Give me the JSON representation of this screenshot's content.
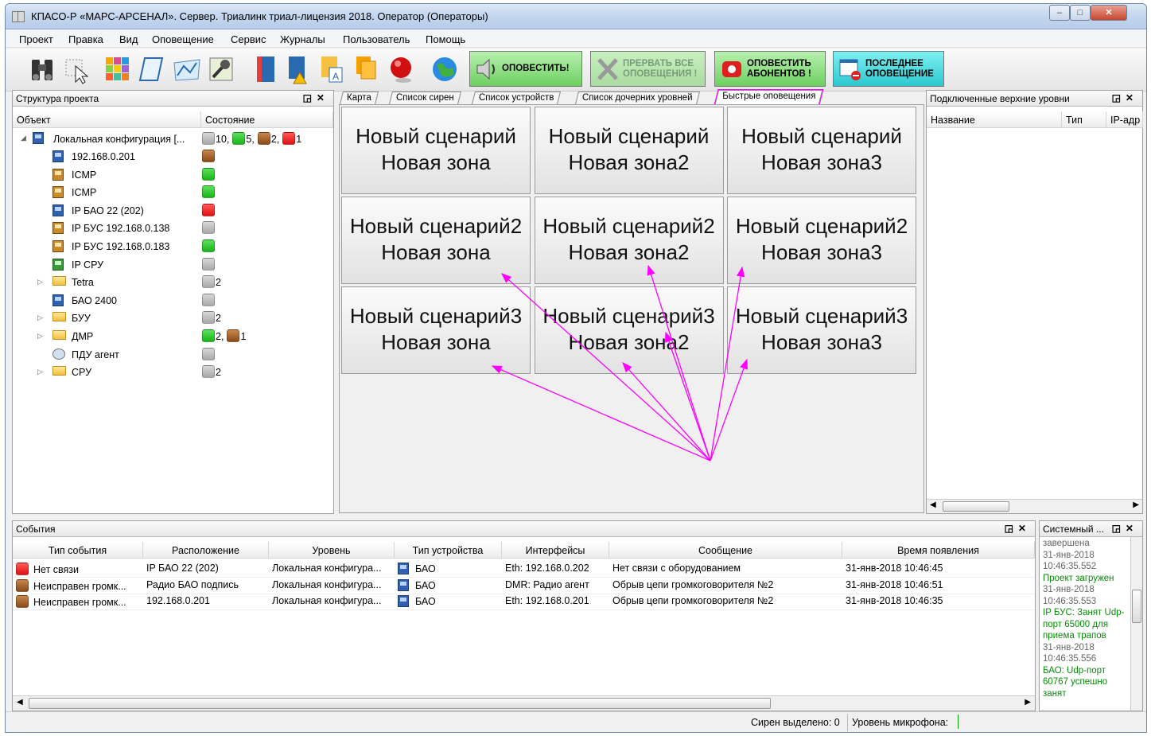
{
  "window": {
    "title": "КПАСО-Р «МАРС-АРСЕНАЛ». Сервер. Триалинк триал-лицензия 2018. Оператор (Операторы)"
  },
  "menu": [
    "Проект",
    "Правка",
    "Вид",
    "Оповещение",
    "Сервис",
    "Журналы",
    "Пользователь",
    "Помощь"
  ],
  "toolbar": {
    "notify_label": "ОПОВЕСТИТЬ!",
    "abort_label_1": "ПРЕРВАТЬ ВСЕ",
    "abort_label_2": "ОПОВЕЩЕНИЯ !",
    "notify_subs_1": "ОПОВЕСТИТЬ",
    "notify_subs_2": "АБОНЕНТОВ !",
    "last_1": "ПОСЛЕДНЕЕ",
    "last_2": "ОПОВЕЩЕНИЕ"
  },
  "project_panel": {
    "title": "Структура проекта",
    "col_object": "Объект",
    "col_state": "Состояние",
    "root": {
      "label": "Локальная конфигурация [...",
      "counts": {
        "gray": "10,",
        "green": "5,",
        "brown": "2,",
        "red": "1"
      }
    },
    "items": [
      {
        "label": "192.168.0.201",
        "status": "brown",
        "icon": "device"
      },
      {
        "label": "ICMP",
        "status": "green",
        "icon": "device-orange"
      },
      {
        "label": "ICMP",
        "status": "green",
        "icon": "device-orange"
      },
      {
        "label": "IP БАО 22 (202)",
        "status": "red",
        "icon": "device"
      },
      {
        "label": "IP БУС 192.168.0.138",
        "status": "gray",
        "icon": "device-orange"
      },
      {
        "label": "IP БУС 192.168.0.183",
        "status": "green",
        "icon": "device-orange"
      },
      {
        "label": "IP СРУ",
        "status": "gray",
        "icon": "device-green"
      },
      {
        "label": "Tetra",
        "status": "gray",
        "count": "2",
        "icon": "folder"
      },
      {
        "label": "БАО 2400",
        "status": "gray",
        "icon": "device"
      },
      {
        "label": "БУУ",
        "status": "gray",
        "count": "2",
        "icon": "folder"
      },
      {
        "label": "ДМР",
        "status": "green",
        "count": "2,",
        "status2": "brown",
        "count2": "1",
        "icon": "folder"
      },
      {
        "label": "ПДУ агент",
        "status": "gray",
        "icon": "agent"
      },
      {
        "label": "СРУ",
        "status": "gray",
        "count": "2",
        "icon": "folder"
      }
    ]
  },
  "tabs": [
    "Карта",
    "Список сирен",
    "Список устройств",
    "Список дочерних уровней",
    "Быстрые оповещения"
  ],
  "quick_buttons": [
    {
      "line1": "Новый сценарий",
      "line2": "Новая зона"
    },
    {
      "line1": "Новый сценарий",
      "line2": "Новая зона2"
    },
    {
      "line1": "Новый сценарий",
      "line2": "Новая зона3"
    },
    {
      "line1": "Новый сценарий2",
      "line2": "Новая зона"
    },
    {
      "line1": "Новый сценарий2",
      "line2": "Новая зона2"
    },
    {
      "line1": "Новый сценарий2",
      "line2": "Новая зона3"
    },
    {
      "line1": "Новый сценарий3",
      "line2": "Новая зона"
    },
    {
      "line1": "Новый сценарий3",
      "line2": "Новая зона2"
    },
    {
      "line1": "Новый сценарий3",
      "line2": "Новая зона3"
    }
  ],
  "upper_panel": {
    "title": "Подключенные верхние уровни",
    "cols": [
      "Название",
      "Тип",
      "IP-адр"
    ]
  },
  "events_panel": {
    "title": "События",
    "cols": [
      "Тип события",
      "Расположение",
      "Уровень",
      "Тип устройства",
      "Интерфейсы",
      "Сообщение",
      "Время появления"
    ],
    "rows": [
      {
        "color": "red",
        "type": "Нет связи",
        "location": "IP БАО 22 (202)",
        "level": "Локальная конфигура...",
        "device": "БАО",
        "iface": "Eth: 192.168.0.202",
        "message": "Нет связи с оборудованием",
        "time": "31-янв-2018 10:46:45"
      },
      {
        "color": "brown",
        "type": "Неисправен громк...",
        "location": "Радио БАО подпись",
        "level": "Локальная конфигура...",
        "device": "БАО",
        "iface": "DMR: Радио агент",
        "message": "Обрыв цепи громкоговорителя №2",
        "time": "31-янв-2018 10:46:51"
      },
      {
        "color": "brown",
        "type": "Неисправен громк...",
        "location": "192.168.0.201",
        "level": "Локальная конфигура...",
        "device": "БАО",
        "iface": "Eth: 192.168.0.201",
        "message": "Обрыв цепи громкоговорителя №2",
        "time": "31-янв-2018 10:46:35"
      }
    ]
  },
  "system_panel": {
    "title": "Системный ...",
    "log": [
      {
        "ts": "завершена",
        "msg": ""
      },
      {
        "ts": "31-янв-2018 10:46:35.552",
        "msg": "Проект загружен"
      },
      {
        "ts": "31-янв-2018 10:46:35.553",
        "msg": "IP БУС: Занят Udp-порт 65000 для приема трапов"
      },
      {
        "ts": "31-янв-2018 10:46:35.556",
        "msg": "БАО: Udp-порт 60767 успешно занят"
      }
    ]
  },
  "status": {
    "sirens": "Сирен выделено: 0",
    "mic": "Уровень микрофона:"
  },
  "colors": {
    "accent_arrows": "#ff00ff",
    "green": "#18b518",
    "red": "#e01010",
    "brown": "#8a4b1a"
  }
}
